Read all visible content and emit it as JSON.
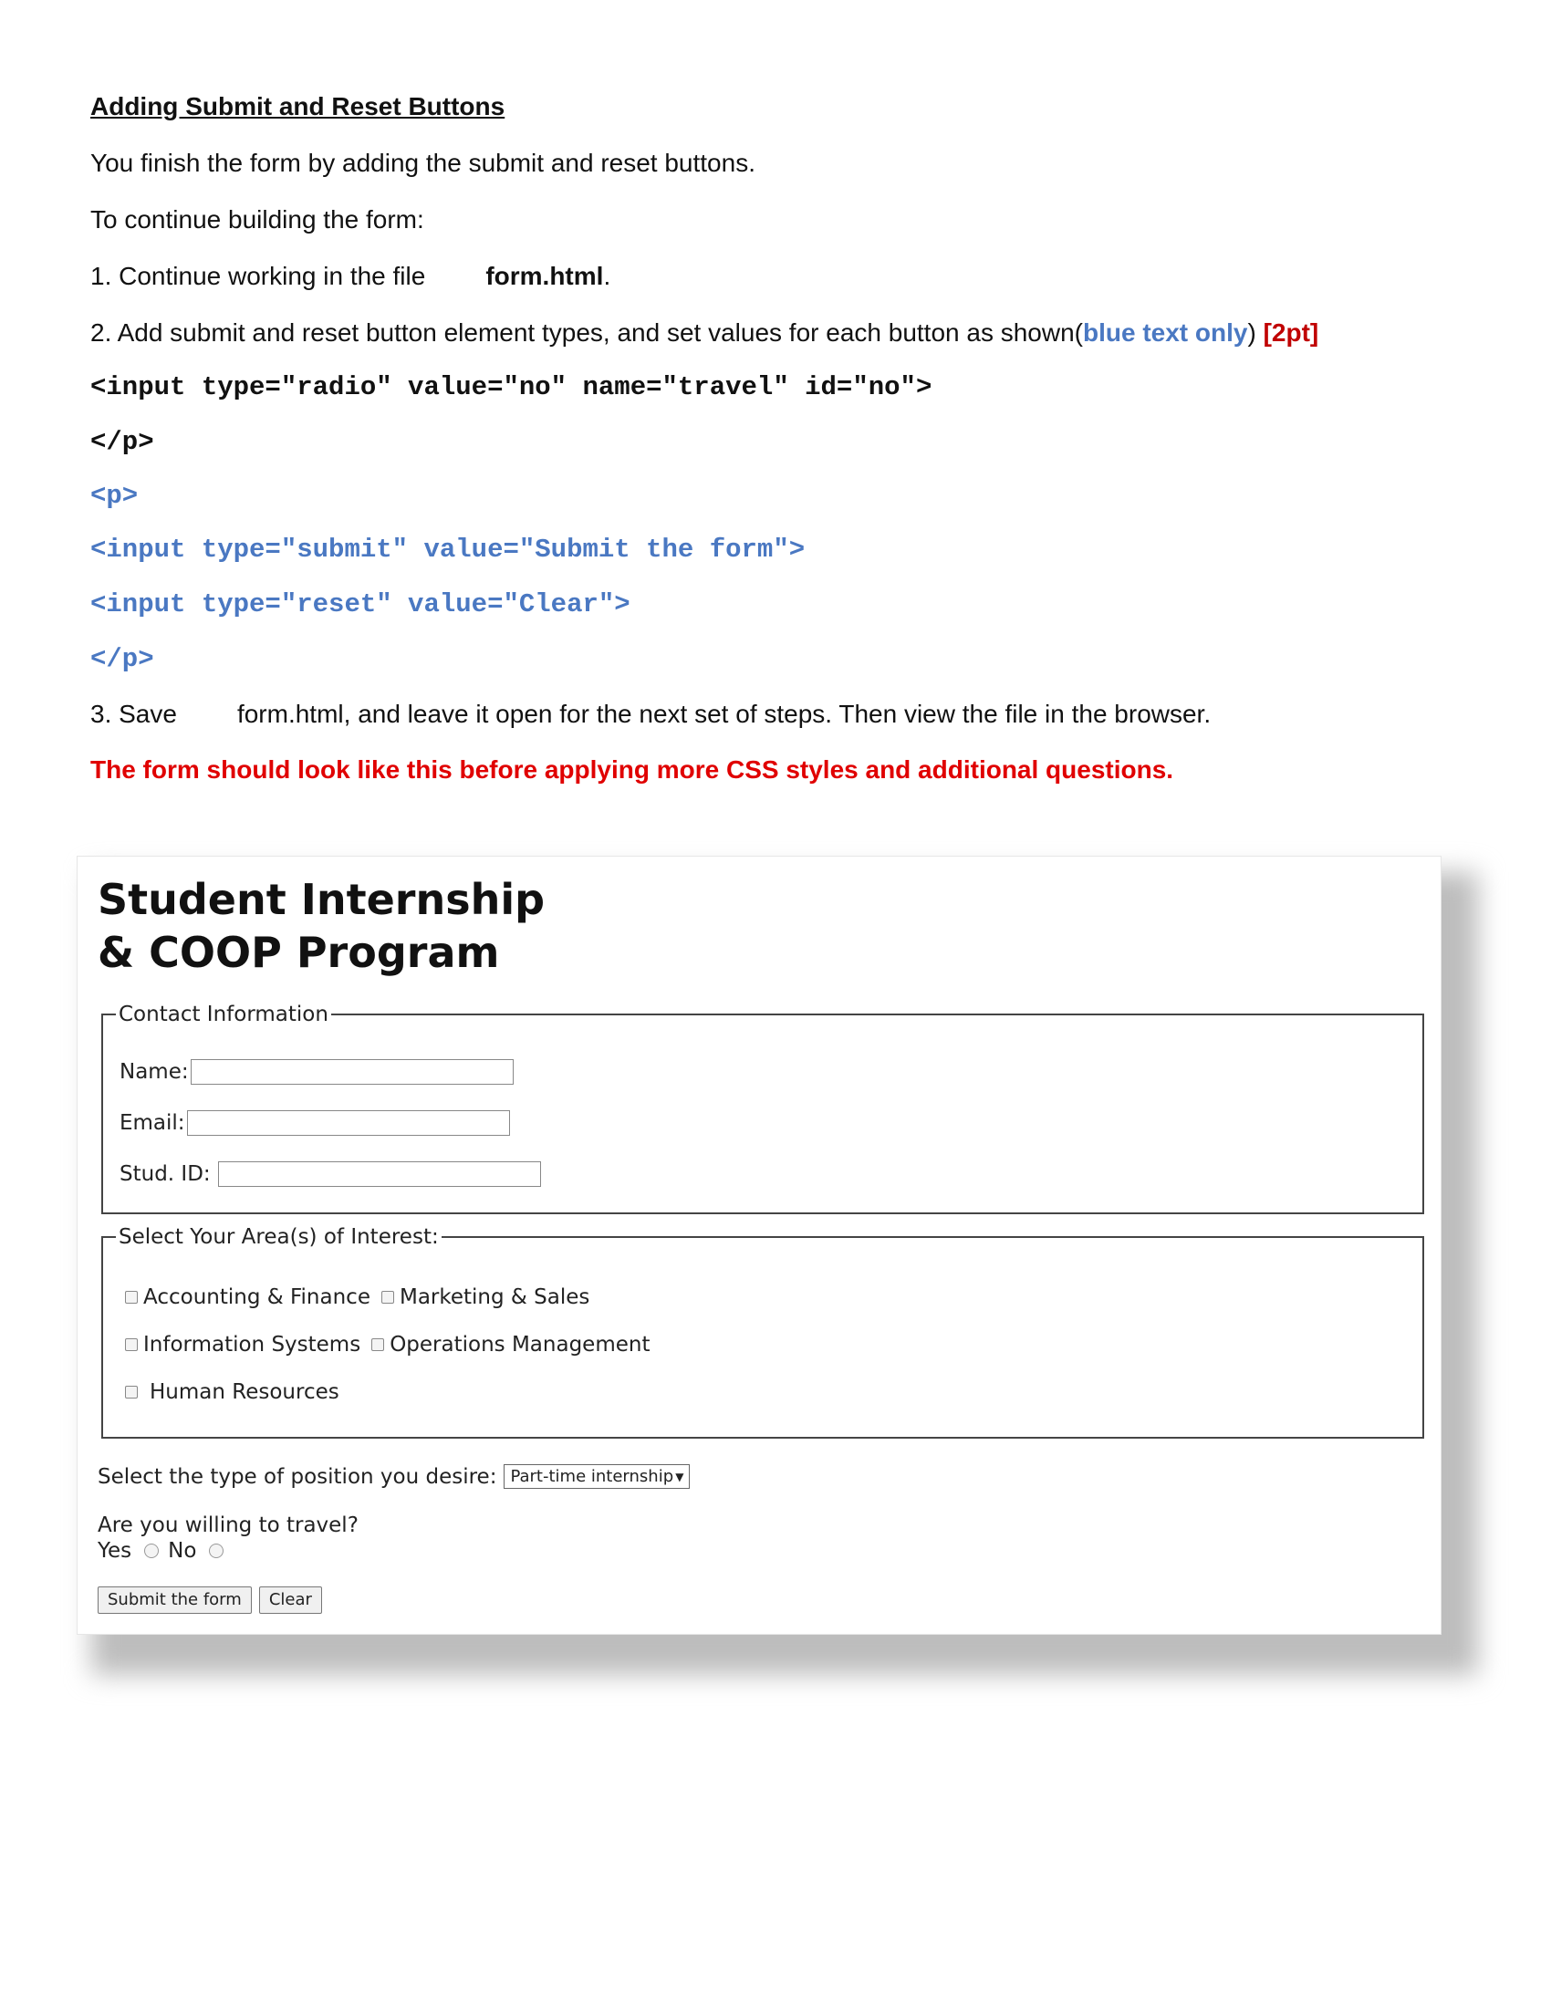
{
  "doc": {
    "heading": "Adding Submit and Reset Buttons",
    "p1": "You finish the form by adding the submit and reset buttons.",
    "p2": "To continue building the form:",
    "step1_text": "1. Continue working in the file",
    "step1_file": "form.html",
    "step1_end": ".",
    "step2_text": "2. Add submit and reset button element types, and set values for each button as shown(",
    "step2_blue": "blue text only",
    "step2_close": ")",
    "step2_points": "[2pt]",
    "code_lines": [
      "<input type=\"radio\" value=\"no\" name=\"travel\" id=\"no\">",
      "</p>",
      "<p>",
      "<input type=\"submit\" value=\"Submit the form\">",
      "<input type=\"reset\" value=\"Clear\">",
      "</p>"
    ],
    "step3_text": "3. Save",
    "step3_rest": "form.html, and leave it open for the next set of steps. Then view the file in the browser.",
    "note": "The form should look like this before applying more CSS styles and additional questions."
  },
  "screenshot": {
    "title_line1": "Student Internship",
    "title_line2": "& COOP Program",
    "contact_legend": "Contact Information",
    "name_label": "Name:",
    "email_label": "Email:",
    "studid_label": "Stud. ID:",
    "interest_legend": "Select Your Area(s) of Interest:",
    "interests": [
      "Accounting & Finance",
      "Marketing & Sales",
      "Information Systems",
      "Operations Management",
      "Human Resources"
    ],
    "position_label": "Select the type of position you desire:",
    "position_selected": "Part-time internship",
    "select_arrow": "▼",
    "travel_question": "Are you willing to travel?",
    "yes_label": "Yes",
    "no_label": "No",
    "submit_label": "Submit the form",
    "clear_label": "Clear"
  }
}
